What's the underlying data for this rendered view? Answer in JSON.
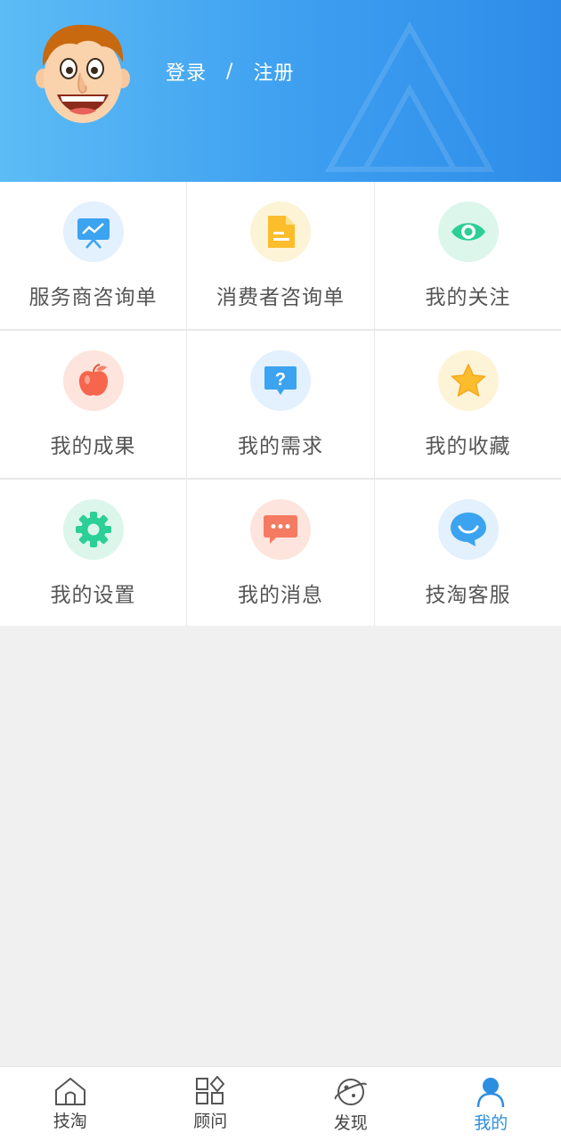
{
  "header": {
    "login_label": "登录",
    "separator": "/",
    "register_label": "注册",
    "background_color": "#3d9ef0"
  },
  "menu": [
    {
      "label": "服务商咨询单",
      "icon": "presentation-board-icon",
      "circle_color": "#e3f0fd",
      "icon_color": "#3ba3ef"
    },
    {
      "label": "消费者咨询单",
      "icon": "document-icon",
      "circle_color": "#fdf3d6",
      "icon_color": "#fbbd2c"
    },
    {
      "label": "我的关注",
      "icon": "eye-icon",
      "circle_color": "#dcf6ec",
      "icon_color": "#2ccf97"
    },
    {
      "label": "我的成果",
      "icon": "apple-icon",
      "circle_color": "#fde4dc",
      "icon_color": "#f5664c"
    },
    {
      "label": "我的需求",
      "icon": "question-bubble-icon",
      "circle_color": "#e3f0fd",
      "icon_color": "#3ba3ef"
    },
    {
      "label": "我的收藏",
      "icon": "star-icon",
      "circle_color": "#fdf3d6",
      "icon_color": "#fbbd2c"
    },
    {
      "label": "我的设置",
      "icon": "gear-icon",
      "circle_color": "#dcf6ec",
      "icon_color": "#2ccf97"
    },
    {
      "label": "我的消息",
      "icon": "message-icon",
      "circle_color": "#fde4dc",
      "icon_color": "#f57a62"
    },
    {
      "label": "技淘客服",
      "icon": "customer-service-icon",
      "circle_color": "#e3f0fd",
      "icon_color": "#3ba3ef"
    }
  ],
  "tabbar": {
    "tabs": [
      {
        "label": "技淘",
        "icon": "home-icon"
      },
      {
        "label": "顾问",
        "icon": "apps-grid-icon"
      },
      {
        "label": "发现",
        "icon": "planet-icon"
      },
      {
        "label": "我的",
        "icon": "person-icon"
      }
    ],
    "active_index": 3,
    "active_color": "#2c8ee0"
  }
}
